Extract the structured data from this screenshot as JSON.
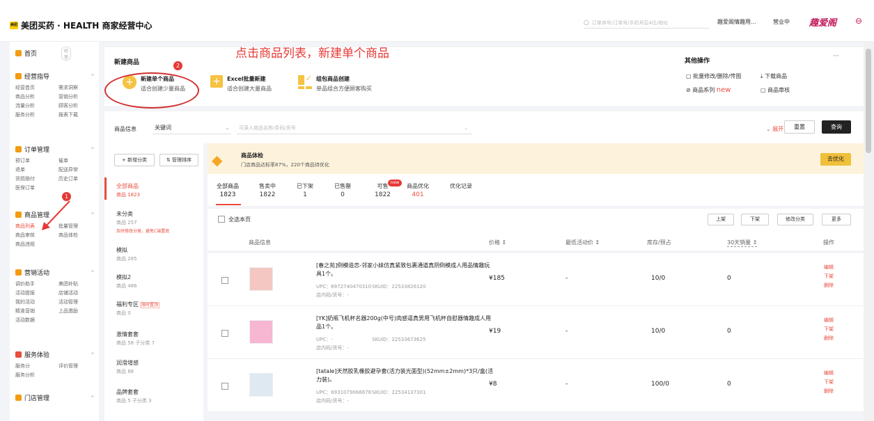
{
  "header": {
    "logo_text": "美团",
    "title": "美团买药 · HEALTH 商家经营中心",
    "search_placeholder": "订单序号/订单号/手机号后4位/地址",
    "shop_name": "趣爱阁情趣用...",
    "status": "营业中",
    "brand_mark": "趣爱阁"
  },
  "sidebar": {
    "home": "首页",
    "home_badge": "经营",
    "groups": [
      {
        "title": "经营指导",
        "color": "#f39c12",
        "items": [
          "经营首页",
          "需求洞察",
          "商品分析",
          "营销分析",
          "流量分析",
          "顾客分析",
          "服务分析",
          "报表下载"
        ]
      },
      {
        "title": "订单管理",
        "color": "#f39c12",
        "items": [
          "预订单",
          "催单",
          "退单",
          "配送异常",
          "货损赔付",
          "历史订单",
          "医保订单"
        ]
      },
      {
        "title": "商品管理",
        "color": "#f39c12",
        "items": [
          "商品列表",
          "批量管理",
          "商品审核",
          "商品体检",
          "商品违规"
        ]
      },
      {
        "title": "营销活动",
        "color": "#f39c12",
        "items": [
          "调价助手",
          "美团补贴",
          "活动提报",
          "店铺活动",
          "我的活动",
          "活动管理",
          "精准营销",
          "上品激励",
          "活动数据"
        ]
      },
      {
        "title": "服务体验",
        "color": "#e94b3c",
        "items": [
          "服务分",
          "评价管理",
          "服务分析"
        ]
      },
      {
        "title": "门店管理",
        "color": "#f39c12",
        "items": []
      }
    ],
    "badge_1": "1"
  },
  "annotation": {
    "text": "点击商品列表，新建单个商品",
    "badge_2": "2"
  },
  "create": {
    "title": "新建商品",
    "options": [
      {
        "title": "新建单个商品",
        "desc": "适合创建少量商品"
      },
      {
        "title": "Excel批量新建",
        "desc": "适合创建大量商品"
      },
      {
        "title": "组包商品创建",
        "desc": "单品组合方便顾客购买"
      }
    ]
  },
  "other_ops": {
    "title": "其他操作",
    "more": "···",
    "items": [
      "批量修改/删除/传图",
      "下载商品",
      "商品系列",
      "商品审核"
    ],
    "new_tag": "new"
  },
  "filter": {
    "label": "商品信息",
    "select_value": "关键词",
    "input_placeholder": "可录入商品名称/条码/货号",
    "expand": "展开",
    "reset": "重置",
    "query": "查询"
  },
  "category_buttons": {
    "add": "+ 新增分类",
    "sort": "管理排序"
  },
  "health_check": {
    "title": "商品体检",
    "desc": "门店商品达标率87%，220个商品待优化",
    "button": "去优化"
  },
  "categories": [
    {
      "name": "全部商品",
      "sub": "商品 1823",
      "active": true
    },
    {
      "name": "未分类",
      "sub": "商品 257",
      "note": "及时修改分类，避免C端置底"
    },
    {
      "name": "模拟",
      "sub": "商品 285"
    },
    {
      "name": "模拟2",
      "sub": "商品 486"
    },
    {
      "name": "福利专区",
      "sub": "商品 0",
      "tag": "限时置顶"
    },
    {
      "name": "激情套套",
      "sub": "商品 58 子分类 7"
    },
    {
      "name": "润滑增感",
      "sub": "商品 88"
    },
    {
      "name": "品牌套套",
      "sub": "商品 5 子分类 3"
    }
  ],
  "tabs": [
    {
      "label": "全部商品",
      "count": "1823"
    },
    {
      "label": "售卖中",
      "count": "1822"
    },
    {
      "label": "已下架",
      "count": "1"
    },
    {
      "label": "已售罄",
      "count": "0"
    },
    {
      "label": "可售",
      "count": "1822"
    },
    {
      "label": "商品优化",
      "count": "401"
    },
    {
      "label": "优化记录",
      "count": ""
    }
  ],
  "tab_new_badge": "new",
  "table": {
    "select_all": "全选本页",
    "actions": [
      "上架",
      "下架",
      "修改分类",
      "更多"
    ],
    "headers": [
      "商品信息",
      "价格 ↕",
      "最低活动价 ↕",
      "库存/预占",
      "30天销量 ↕",
      "操作"
    ],
    "rows": [
      {
        "name": "[春之苑]倒模造恋-邻家小妹仿真紧致包裹通道真阴倒模成人用品情趣玩具1个。",
        "upc": "UPC：6972740470310",
        "skuid": "SKUID：22533826120",
        "code": "店内码/货号：-",
        "price": "¥185",
        "min_price": "-",
        "stock": "10/0",
        "sales": "0",
        "ops": [
          "编辑",
          "下架",
          "删除"
        ]
      },
      {
        "name": "[YK]奶瓶飞机杯名器200g(中号)肉感逼真男用飞机杯自慰器情趣成人用品1个。",
        "upc": "UPC：-",
        "skuid": "SKUID：22533673625",
        "code": "店内码/货号：-",
        "price": "¥19",
        "min_price": "-",
        "stock": "10/0",
        "sales": "0",
        "ops": [
          "编辑",
          "下架",
          "删除"
        ]
      },
      {
        "name": "[tatale]天然胶乳橡胶避孕套(活力装光面型)(52mm±2mm)*3只/盒(活力装)。",
        "upc": "UPC：6931079066878",
        "skuid": "SKUID：22534137301",
        "code": "店内码/货号：-",
        "price": "¥8",
        "min_price": "-",
        "stock": "100/0",
        "sales": "0",
        "ops": [
          "编辑",
          "下架",
          "删除"
        ]
      }
    ]
  }
}
